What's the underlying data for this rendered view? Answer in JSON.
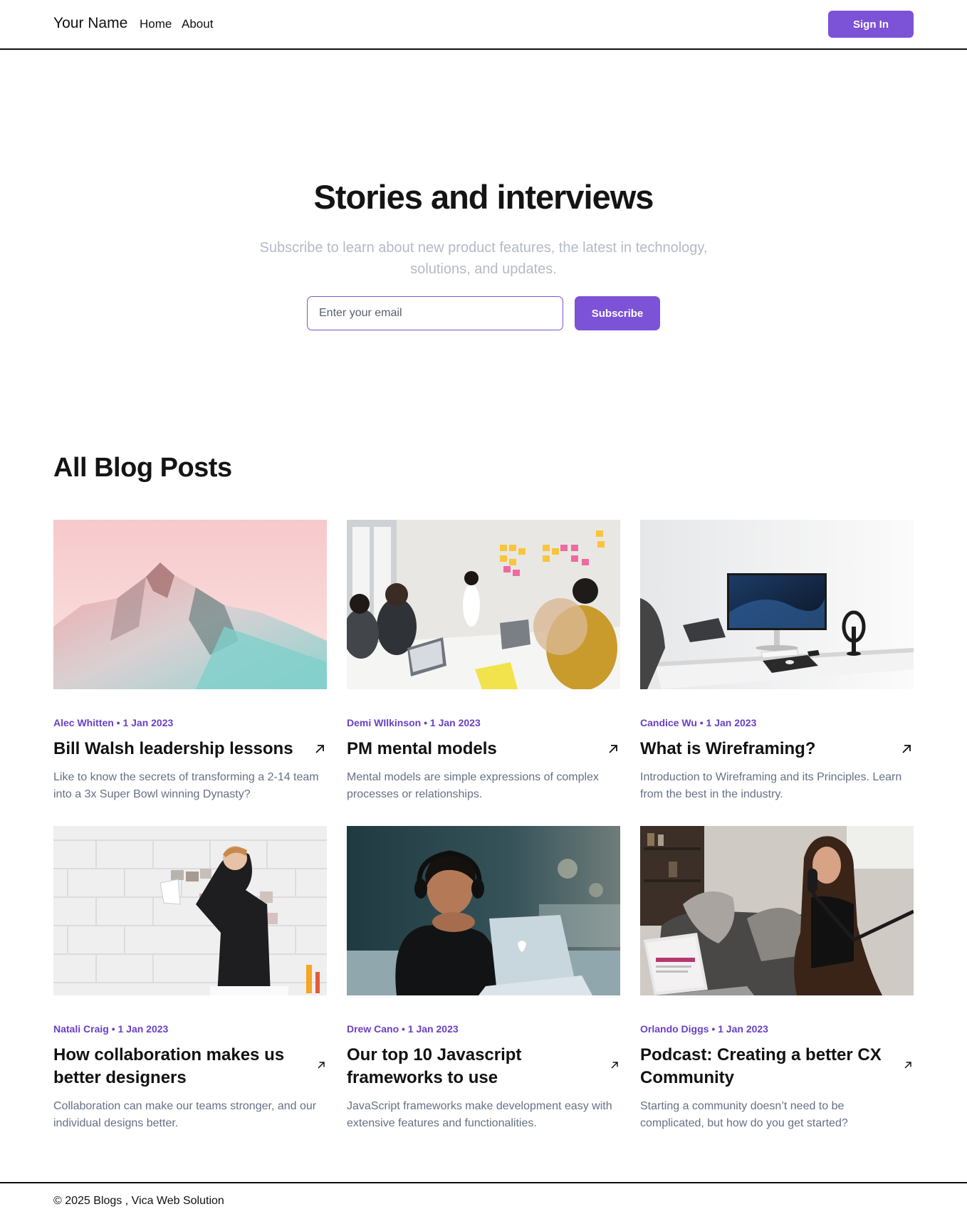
{
  "header": {
    "brand": "Your Name",
    "nav": [
      {
        "label": "Home"
      },
      {
        "label": "About"
      }
    ],
    "signin_label": "Sign In"
  },
  "hero": {
    "title": "Stories and interviews",
    "subtitle": "Subscribe to learn about new product features, the latest in technology, solutions, and updates.",
    "email_placeholder": "Enter your email",
    "subscribe_label": "Subscribe"
  },
  "section": {
    "title": "All Blog Posts"
  },
  "posts": [
    {
      "meta": "Alec Whitten • 1 Jan 2023",
      "title": "Bill Walsh leadership lessons",
      "description": "Like to know the secrets of transforming a 2-14 team into a 3x Super Bowl winning Dynasty?",
      "image": "mountain-photo"
    },
    {
      "meta": "Demi WIlkinson • 1 Jan 2023",
      "title": "PM mental models",
      "description": "Mental models are simple expressions of complex processes or relationships.",
      "image": "team-meeting-photo"
    },
    {
      "meta": "Candice Wu • 1 Jan 2023",
      "title": "What is Wireframing?",
      "description": "Introduction to Wireframing and its Principles. Learn from the best in the industry.",
      "image": "desk-setup-photo"
    },
    {
      "meta": "Natali Craig • 1 Jan 2023",
      "title": "How collaboration makes us better designers",
      "description": "Collaboration can make our teams stronger, and our individual designs better.",
      "image": "wall-notes-photo"
    },
    {
      "meta": "Drew Cano • 1 Jan 2023",
      "title": "Our top 10 Javascript frameworks to use",
      "description": "JavaScript frameworks make development easy with extensive features and functionalities.",
      "image": "laptop-thinker-photo"
    },
    {
      "meta": "Orlando Diggs • 1 Jan 2023",
      "title": "Podcast: Creating a better CX Community",
      "description": "Starting a community doesn’t need to be complicated, but how do you get started?",
      "image": "podcast-photo"
    }
  ],
  "footer": {
    "text": "© 2025 Blogs , Vica Web Solution"
  },
  "colors": {
    "accent": "#7c52d6",
    "meta": "#6b3fc5",
    "muted": "#667085",
    "subtitle": "#b5b9c6"
  }
}
